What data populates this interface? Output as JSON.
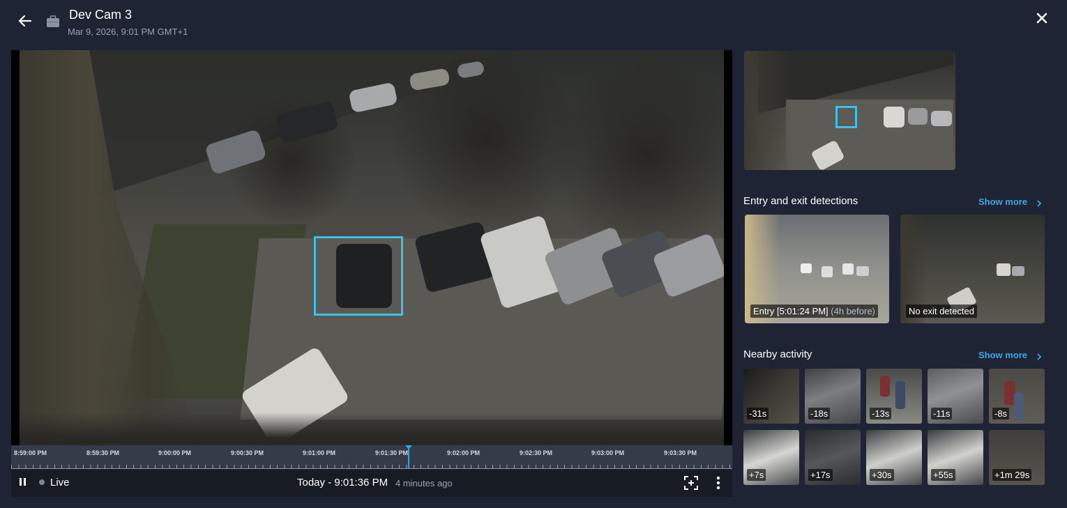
{
  "header": {
    "title": "Dev Cam 3",
    "subtitle": "Mar 9, 2026, 9:01 PM GMT+1",
    "back_icon": "arrow-left-icon",
    "camera_icon": "briefcase-icon",
    "close_icon": "close-icon"
  },
  "colors": {
    "background": "#1e2433",
    "accent": "#3ba7e6",
    "detection_box": "#3fc0e8",
    "timeline_cursor": "#29a8e0"
  },
  "timeline": {
    "labels": [
      "8:59:00 PM",
      "8:59:30 PM",
      "9:00:00 PM",
      "9:00:30 PM",
      "9:01:00 PM",
      "9:01:30 PM",
      "9:02:00 PM",
      "9:02:30 PM",
      "9:03:00 PM",
      "9:03:30 PM"
    ]
  },
  "controls": {
    "live_label": "Live",
    "current_time": "Today - 9:01:36 PM",
    "time_ago": "4 minutes ago",
    "pause_icon": "pause-icon",
    "focus_icon": "focus-frame-icon",
    "more_icon": "more-vertical-icon"
  },
  "entry_exit": {
    "title": "Entry and exit detections",
    "show_more": "Show more",
    "entry_label": "Entry [5:01:24 PM]",
    "entry_detail": "(4h before)",
    "exit_label": "No exit detected"
  },
  "nearby": {
    "title": "Nearby activity",
    "show_more": "Show more",
    "items": [
      {
        "offset": "-31s"
      },
      {
        "offset": "-18s"
      },
      {
        "offset": "-13s"
      },
      {
        "offset": "-11s"
      },
      {
        "offset": "-8s"
      },
      {
        "offset": "+7s"
      },
      {
        "offset": "+17s"
      },
      {
        "offset": "+30s"
      },
      {
        "offset": "+55s"
      },
      {
        "offset": "+1m 29s"
      }
    ]
  }
}
